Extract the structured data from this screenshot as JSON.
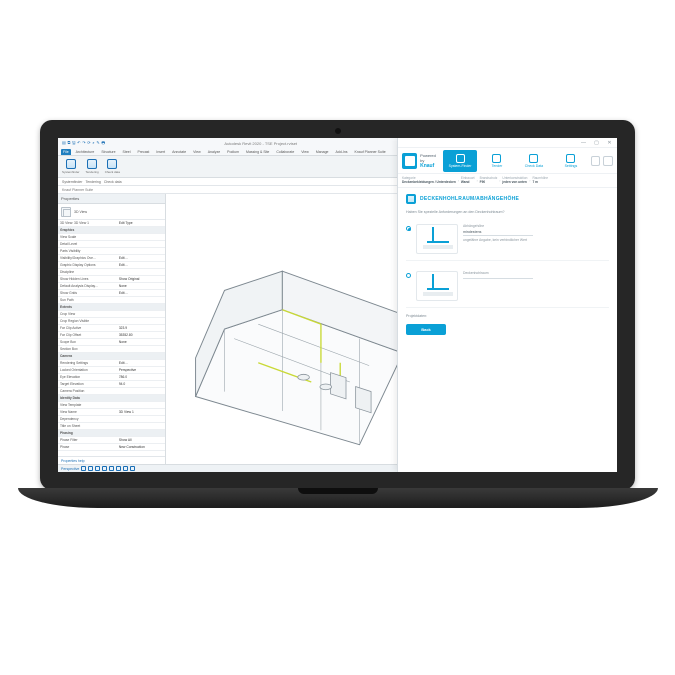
{
  "revit": {
    "app_title": "Autodesk Revit 2020 - TSE Project.rvtset",
    "qat_icons": [
      "menu",
      "open",
      "save",
      "undo",
      "redo",
      "sync",
      "measure",
      "section",
      "print"
    ],
    "tabs": [
      "File",
      "Architecture",
      "Structure",
      "Steel",
      "Precast",
      "Insert",
      "Annotate",
      "View",
      "Analyze",
      "Podium",
      "Massing & Site",
      "Collaborate",
      "View",
      "Manage",
      "Add-Ins",
      "Knauf Planner Suite"
    ],
    "active_tab_index": 0,
    "ribbon_groups": [
      {
        "label": "Systemfinder"
      },
      {
        "label": "Tendering"
      },
      {
        "label": "Check data"
      }
    ],
    "subbar": [
      "Systemfinder",
      "Tendering",
      "Check data"
    ],
    "sub2_label": "Knauf Planner Suite",
    "properties": {
      "panel_title": "Properties",
      "type_label": "3D View",
      "type_selector_row": {
        "label": "3D View: 3D View 1",
        "button": "Edit Type"
      },
      "sections": [
        {
          "name": "Graphics",
          "rows": [
            {
              "k": "View Scale",
              "v": ""
            },
            {
              "k": "Detail Level",
              "v": ""
            },
            {
              "k": "Parts Visibility",
              "v": ""
            },
            {
              "k": "Visibility/Graphics Ove…",
              "v": "Edit…"
            },
            {
              "k": "Graphic Display Options",
              "v": "Edit…"
            },
            {
              "k": "Discipline",
              "v": ""
            },
            {
              "k": "Show Hidden Lines",
              "v": "Show Original"
            },
            {
              "k": "Default Analysis Display…",
              "v": "None"
            },
            {
              "k": "Show Grids",
              "v": "Edit…"
            },
            {
              "k": "Sun Path",
              "v": ""
            }
          ]
        },
        {
          "name": "Extents",
          "rows": [
            {
              "k": "Crop View",
              "v": ""
            },
            {
              "k": "Crop Region Visible",
              "v": ""
            },
            {
              "k": "Far Clip Active",
              "v": "323.9"
            },
            {
              "k": "Far Clip Offset",
              "v": "35352.80"
            },
            {
              "k": "Scope Box",
              "v": "None"
            },
            {
              "k": "Section Box",
              "v": ""
            }
          ]
        },
        {
          "name": "Camera",
          "rows": [
            {
              "k": "Rendering Settings",
              "v": "Edit…"
            },
            {
              "k": "Locked Orientation",
              "v": "Perspective"
            },
            {
              "k": "Eye Elevation",
              "v": "786.0"
            },
            {
              "k": "Target Elevation",
              "v": "94.0"
            },
            {
              "k": "Camera Position",
              "v": ""
            }
          ]
        },
        {
          "name": "Identity Data",
          "rows": [
            {
              "k": "View Template",
              "v": "<None>"
            },
            {
              "k": "View Name",
              "v": "3D View 1"
            },
            {
              "k": "Dependency",
              "v": ""
            },
            {
              "k": "Title on Sheet",
              "v": ""
            }
          ]
        },
        {
          "name": "Phasing",
          "rows": [
            {
              "k": "Phase Filter",
              "v": "Show All"
            },
            {
              "k": "Phase",
              "v": "New Construction"
            }
          ]
        }
      ],
      "help_link": "Properties help"
    },
    "statusbar_label": "Perspective"
  },
  "plugin": {
    "window_title": "",
    "powered_by_label": "Powered by",
    "brand": "Knauf",
    "nav": [
      {
        "label": "System-Finder",
        "active": true
      },
      {
        "label": "Tender",
        "active": false
      },
      {
        "label": "Check Data",
        "active": false
      },
      {
        "label": "Settings",
        "active": false
      }
    ],
    "breadcrumb": [
      {
        "label": "Kategorie",
        "value": "Deckenbekleidungen / Unterdecken"
      },
      {
        "label": "Einbauort",
        "value": "Wand"
      },
      {
        "label": "Brandschutz",
        "value": "F90"
      },
      {
        "label": "Unterkonstruktion",
        "value": "jeden von unten"
      },
      {
        "label": "Raumhöhe",
        "value": "7 m"
      }
    ],
    "section": {
      "title": "DECKENHOHLRAUM/ABHÄNGEHÖHE",
      "subtitle": "Haben Sie spezielle Anforderungen an den Deckenhohlraum?"
    },
    "options": [
      {
        "label": "Abhängehöhe",
        "value": "",
        "unit": "mindestens",
        "note": "ungefähre Angabe, kein verbindlicher Wert",
        "selected": true
      },
      {
        "label": "Deckenhohlraum",
        "value": "",
        "unit": "",
        "note": "",
        "selected": false
      }
    ],
    "footer_label": "Projektdaten:",
    "back_button": "Back"
  }
}
